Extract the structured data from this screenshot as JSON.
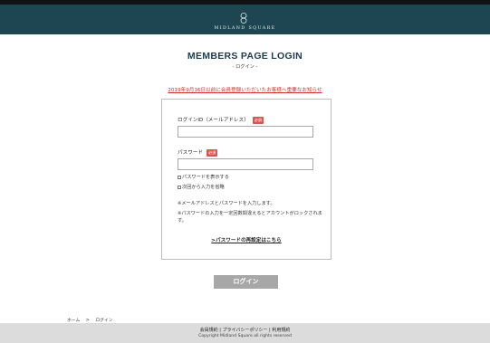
{
  "header": {
    "logo_text": "MIDLAND SQUARE",
    "brand_color": "#1d4652"
  },
  "page": {
    "title": "MEMBERS PAGE LOGIN",
    "subtitle": "- ログイン -",
    "notice": "2019年9月16日以前に会員登録いただいたお客様へ重要なお知らせ",
    "notice_color": "#d12f2a"
  },
  "form": {
    "login_id_label": "ログインID（メールアドレス）",
    "password_label": "パスワード",
    "required_badge": "必須",
    "login_id_value": "",
    "password_value": "",
    "show_password_label": "パスワードを表示する",
    "remember_label": "次回から入力を省略",
    "note_1": "※メールアドレスとパスワードを入力します。",
    "note_2": "※パスワードの入力を一定回数間違えるとアカウントがロックされます。",
    "reset_link": ">パスワードの再設定はこちら",
    "submit_label": "ログイン"
  },
  "breadcrumb": {
    "home": "ホーム",
    "separator": ">",
    "current": "ログイン"
  },
  "footer": {
    "link_terms": "会員規約",
    "link_privacy": "プライバシーポリシー",
    "link_usage": "利用規約",
    "separator": "|",
    "copyright": "Copyright Midland Square all rights reserved"
  }
}
